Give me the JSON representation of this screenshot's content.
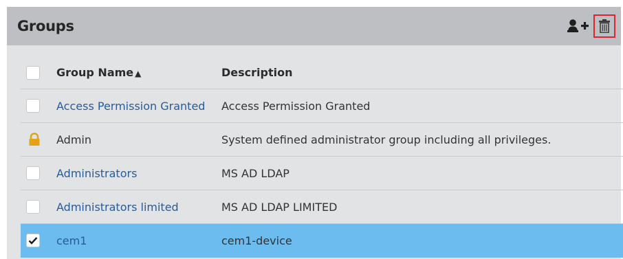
{
  "header": {
    "title": "Groups",
    "add_group_icon": "add-user-icon",
    "delete_icon": "trash-icon"
  },
  "table": {
    "columns": {
      "name": "Group Name",
      "sort_indicator": "▲",
      "description": "Description"
    },
    "rows": [
      {
        "name": "Access Permission Granted",
        "description": "Access Permission Granted",
        "type": "link",
        "checked": false
      },
      {
        "name": "Admin",
        "description": "System defined administrator group including all privileges.",
        "type": "locked",
        "checked": false
      },
      {
        "name": "Administrators",
        "description": "MS AD LDAP",
        "type": "link",
        "checked": false
      },
      {
        "name": "Administrators limited",
        "description": "MS AD LDAP LIMITED",
        "type": "link",
        "checked": false
      },
      {
        "name": "cem1",
        "description": "cem1-device",
        "type": "link",
        "checked": true
      }
    ]
  },
  "colors": {
    "header_bg": "#bdbfc2",
    "panel_bg": "#e2e3e5",
    "link": "#2a5a98",
    "selected_row": "#6cbcef",
    "lock": "#e0a416",
    "delete_highlight": "#e0262b"
  }
}
